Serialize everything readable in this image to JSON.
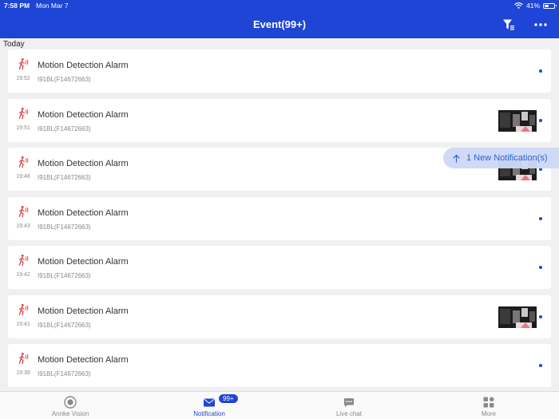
{
  "status_bar": {
    "time": "7:58 PM",
    "date": "Mon Mar 7",
    "battery": "41%",
    "battery_level": 0.41
  },
  "header": {
    "title": "Event(99+)",
    "filter_icon": "filter-icon",
    "more_icon": "more-icon"
  },
  "section": {
    "label": "Today"
  },
  "events": [
    {
      "title": "Motion Detection Alarm",
      "device": "I91BL(F14672663)",
      "time": "19:52",
      "thumbnail": false,
      "unread": true
    },
    {
      "title": "Motion Detection Alarm",
      "device": "I91BL(F14672663)",
      "time": "19:51",
      "thumbnail": true,
      "unread": true
    },
    {
      "title": "Motion Detection Alarm",
      "device": "I91BL(F14672663)",
      "time": "19:48",
      "thumbnail": true,
      "unread": true
    },
    {
      "title": "Motion Detection Alarm",
      "device": "I91BL(F14672663)",
      "time": "19:43",
      "thumbnail": false,
      "unread": true
    },
    {
      "title": "Motion Detection Alarm",
      "device": "I91BL(F14672663)",
      "time": "19:42",
      "thumbnail": false,
      "unread": true
    },
    {
      "title": "Motion Detection Alarm",
      "device": "I91BL(F14672663)",
      "time": "19:41",
      "thumbnail": true,
      "unread": true
    },
    {
      "title": "Motion Detection Alarm",
      "device": "I91BL(F14672663)",
      "time": "19:39",
      "thumbnail": false,
      "unread": true
    }
  ],
  "toast": {
    "text": "1 New Notification(s)"
  },
  "tabs": [
    {
      "label": "Annke Vision",
      "icon": "camera-lens-icon"
    },
    {
      "label": "Notification",
      "icon": "envelope-icon",
      "badge": "99+",
      "active": true
    },
    {
      "label": "Live chat",
      "icon": "chat-bubble-icon"
    },
    {
      "label": "More",
      "icon": "grid-icon"
    }
  ],
  "colors": {
    "accent": "#1f45d6",
    "alarm_icon": "#e24a4a",
    "background": "#f0f0f3"
  }
}
